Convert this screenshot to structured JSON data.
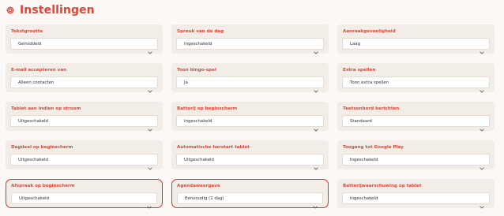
{
  "header": {
    "title": "Instellingen",
    "icon": "gear-icon",
    "accent_color": "#d9483b"
  },
  "settings": [
    {
      "label": "Tekstgrootte",
      "value": "Gemiddeld"
    },
    {
      "label": "Spreuk van de dag",
      "value": "Ingeschakeld"
    },
    {
      "label": "Aanraakgevoeligheid",
      "value": "Laag"
    },
    {
      "label": "E-mail accepteren van",
      "value": "Alleen contacten"
    },
    {
      "label": "Toon bingo-spel",
      "value": "Ja"
    },
    {
      "label": "Extra spellen",
      "value": "Toon extra spellen"
    },
    {
      "label": "Tablet aan indien op stroom",
      "value": "Uitgeschakeld"
    },
    {
      "label": "Batterij op beginscherm",
      "value": "Ingeschakeld"
    },
    {
      "label": "Teetsonbord berichten",
      "value": "Standaard"
    },
    {
      "label": "Dagdeel op beginscherm",
      "value": "Uitgeschakeld"
    },
    {
      "label": "Automatische herstart tablet",
      "value": "Uitgeschakeld"
    },
    {
      "label": "Toegang tot Google Play",
      "value": "Ingeschakeld"
    },
    {
      "label": "Afspraak op beginscherm",
      "value": "Uitgeschakeld",
      "highlighted": true
    },
    {
      "label": "Agendaweergave",
      "value": "Eenvoudig (1 dag)",
      "highlighted": true
    },
    {
      "label": "Batterijwaarschuwing op tablet",
      "value": "Ingeschakeld"
    }
  ]
}
